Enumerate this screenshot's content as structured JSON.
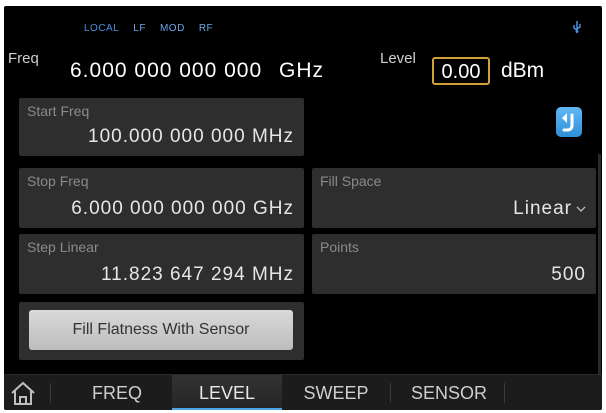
{
  "status": {
    "local": "LOCAL",
    "lf": "LF",
    "mod": "MOD",
    "rf": "RF"
  },
  "header": {
    "freq_label": "Freq",
    "freq_value": "6.000 000 000 000",
    "freq_unit": "GHz",
    "level_label": "Level",
    "level_value": "0.00",
    "level_unit": "dBm"
  },
  "fields": {
    "start": {
      "label": "Start Freq",
      "value": "100.000 000 000 MHz"
    },
    "stop": {
      "label": "Stop Freq",
      "value": "6.000 000 000 000 GHz"
    },
    "step": {
      "label": "Step Linear",
      "value": "11.823 647 294 MHz"
    },
    "fill": {
      "label": "Fill Space",
      "value": "Linear"
    },
    "points": {
      "label": "Points",
      "value": "500"
    }
  },
  "buttons": {
    "fill_flatness": "Fill Flatness With Sensor"
  },
  "tabs": [
    {
      "label": "FREQ"
    },
    {
      "label": "LEVEL"
    },
    {
      "label": "SWEEP"
    },
    {
      "label": "SENSOR"
    }
  ],
  "colors": {
    "accent_blue": "#4aa6e8",
    "level_border": "#d4a03a"
  },
  "icons": {
    "back": "back-arrow-icon",
    "home": "home-icon",
    "usb": "usb-icon"
  }
}
